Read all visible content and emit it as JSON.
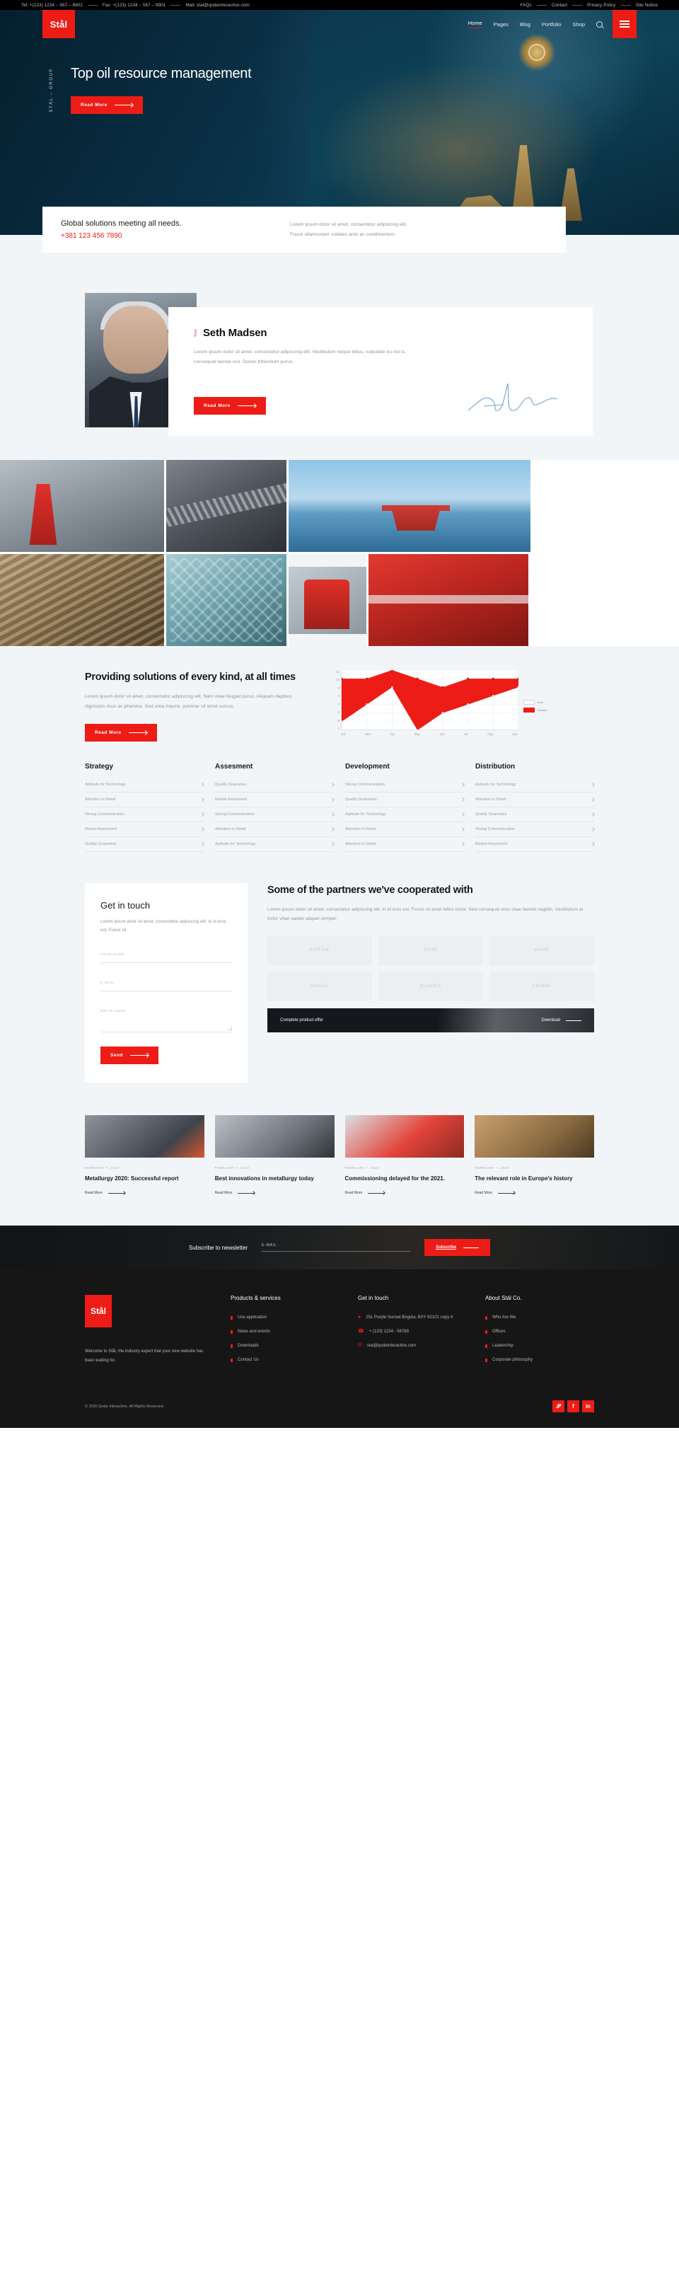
{
  "topbar": {
    "tel": "Tel: +(123) 1234 – 567 – 8901",
    "fax": "Fax: +(123) 1234 – 567 – 8901",
    "mail": "Mail: stal@qodeinteractive.com",
    "links": [
      "FAQs",
      "Contact",
      "Privacy Policy",
      "Site Notice"
    ]
  },
  "header": {
    "logo": "Stål",
    "nav": [
      "Home",
      "Pages",
      "Blog",
      "Portfolio",
      "Shop"
    ],
    "search_icon": "search-icon",
    "menu_icon": "hamburger-icon"
  },
  "hero": {
    "eyebrow": "STÅL – GROUP",
    "title": "Top oil resource management",
    "cta": "Read More"
  },
  "infocard": {
    "title": "Global solutions meeting all needs.",
    "phone": "+381 123 456 7890",
    "text_line1": "Lorem ipsum dolor sit amet, consectetur adipiscing elit.",
    "text_line2": "Fusce ullamcorper sodales ante ac condimentum."
  },
  "person": {
    "eyebrow": "Seo",
    "name": "Seth Madsen",
    "text": "Lorem ipsum dolor sit amet, consectetur adipiscing elit. Vestibulum neque tellus, vulputate eu nisl a, consequat lacinia orci. Donec bibendum purus.",
    "cta": "Read More"
  },
  "solutions": {
    "title": "Providing solutions of every kind, at all times",
    "text": "Lorem ipsum dolor sit amet, consectetur adipiscing elit. Nam vitae feugiat purus. Aliquam dapibus dignissim risus ac pharetra. Sed urna mauris, pulvinar sit amet cursus.",
    "cta": "Read More"
  },
  "chart_data": {
    "type": "area",
    "title": "",
    "xlabel": "",
    "ylabel": "",
    "categories": [
      "Jan",
      "Mar",
      "Apr",
      "May",
      "Jun",
      "Jul",
      "Aug",
      "Sep"
    ],
    "yticks": [
      11,
      10,
      9,
      8,
      7,
      6,
      5,
      4
    ],
    "ylim": [
      4,
      11
    ],
    "grid": true,
    "legend_position": "right",
    "series": [
      {
        "name": "First",
        "color": "#ffffff",
        "values": [
          5,
          7,
          9,
          4,
          6,
          7,
          8,
          9
        ]
      },
      {
        "name": "Second",
        "color": "#ed1c16",
        "values": [
          10,
          10,
          11,
          10,
          9,
          10,
          10,
          10
        ]
      }
    ]
  },
  "fourcol": [
    {
      "title": "Strategy",
      "items": [
        "Aptitude for Technology",
        "Attention to Detail",
        "Strong Communication",
        "Market Assesment",
        "Quality Guarantee"
      ]
    },
    {
      "title": "Assesment",
      "items": [
        "Quality Guarantee",
        "Market Assesment",
        "Strong Communication",
        "Attention to Detail",
        "Aptitude for Technology"
      ]
    },
    {
      "title": "Development",
      "items": [
        "Strong Communication",
        "Quality Guarantee",
        "Aptitude for Technology",
        "Attention to Detail",
        "Attention to Detail"
      ]
    },
    {
      "title": "Distribution",
      "items": [
        "Aptitude for Technology",
        "Attention to Detail",
        "Quality Guarantee",
        "Strong Communication",
        "Market Assesment"
      ]
    }
  ],
  "contact_form": {
    "title": "Get in touch",
    "text": "Lorem ipsum dolor sit amet, consectetur adipiscing elit. In id eros est. Fusce sit.",
    "name_label": "YOUR NAME",
    "email_label": "E-MAIL",
    "message_label": "WRITE HERE",
    "submit": "Send"
  },
  "partners": {
    "title": "Some of the partners we've cooperated with",
    "text": "Lorem ipsum dolor sit amet, consectetur adipiscing elit. In id eros est. Fusce sit amet tellus tortor. Sed consequat eros vitae laoreet sagittis. Vestibulum at tortor vitae sapien aliquet semper.",
    "logos": [
      "ARROW",
      "GRID",
      "WAVE",
      "ANGLE",
      "BLOCKS",
      "FRAME"
    ],
    "promo_text": "Complete product offer",
    "promo_cta": "Download"
  },
  "blog": [
    {
      "date": "FEBRUARY 7, 2020",
      "title": "Metallurgy 2020: Successful report",
      "cta": "Read More"
    },
    {
      "date": "FEBRUARY 7, 2020",
      "title": "Best innovations in metallurgy today",
      "cta": "Read More"
    },
    {
      "date": "FEBRUARY 7, 2020",
      "title": "Commissioning delayed for the 2021.",
      "cta": "Read More"
    },
    {
      "date": "FEBRUARY 7, 2020",
      "title": "The relevant role in Europe's history",
      "cta": "Read More"
    }
  ],
  "newsletter": {
    "title": "Subscribe to newsletter",
    "placeholder": "E-MAIL",
    "button": "Subscribe"
  },
  "footer": {
    "logo": "Stål",
    "about": "Welcome to Stål, the industry expert that your new website has been waiting for.",
    "col1_title": "Products & services",
    "col1": [
      "Use application",
      "News and events",
      "Downloads",
      "Contact Us"
    ],
    "col2_title": "Get in touch",
    "address": "251 Purple Sunset Bogota, BXY 92101 copy 4",
    "phone": "+ (123) 1234 - 56789",
    "email": "stal@qodeinteractive.com",
    "col3_title": "About Stál Co.",
    "col3": [
      "Who Are We",
      "Offices",
      "Leadership",
      "Corporate philosophy"
    ],
    "copyright": "© 2020 Qode Interactive, All Rights Reserved",
    "socials": [
      "twitter-icon",
      "facebook-icon",
      "linkedin-icon"
    ]
  },
  "colors": {
    "accent": "#ed1c16",
    "dark": "#161616",
    "bg": "#f2f5f7"
  }
}
